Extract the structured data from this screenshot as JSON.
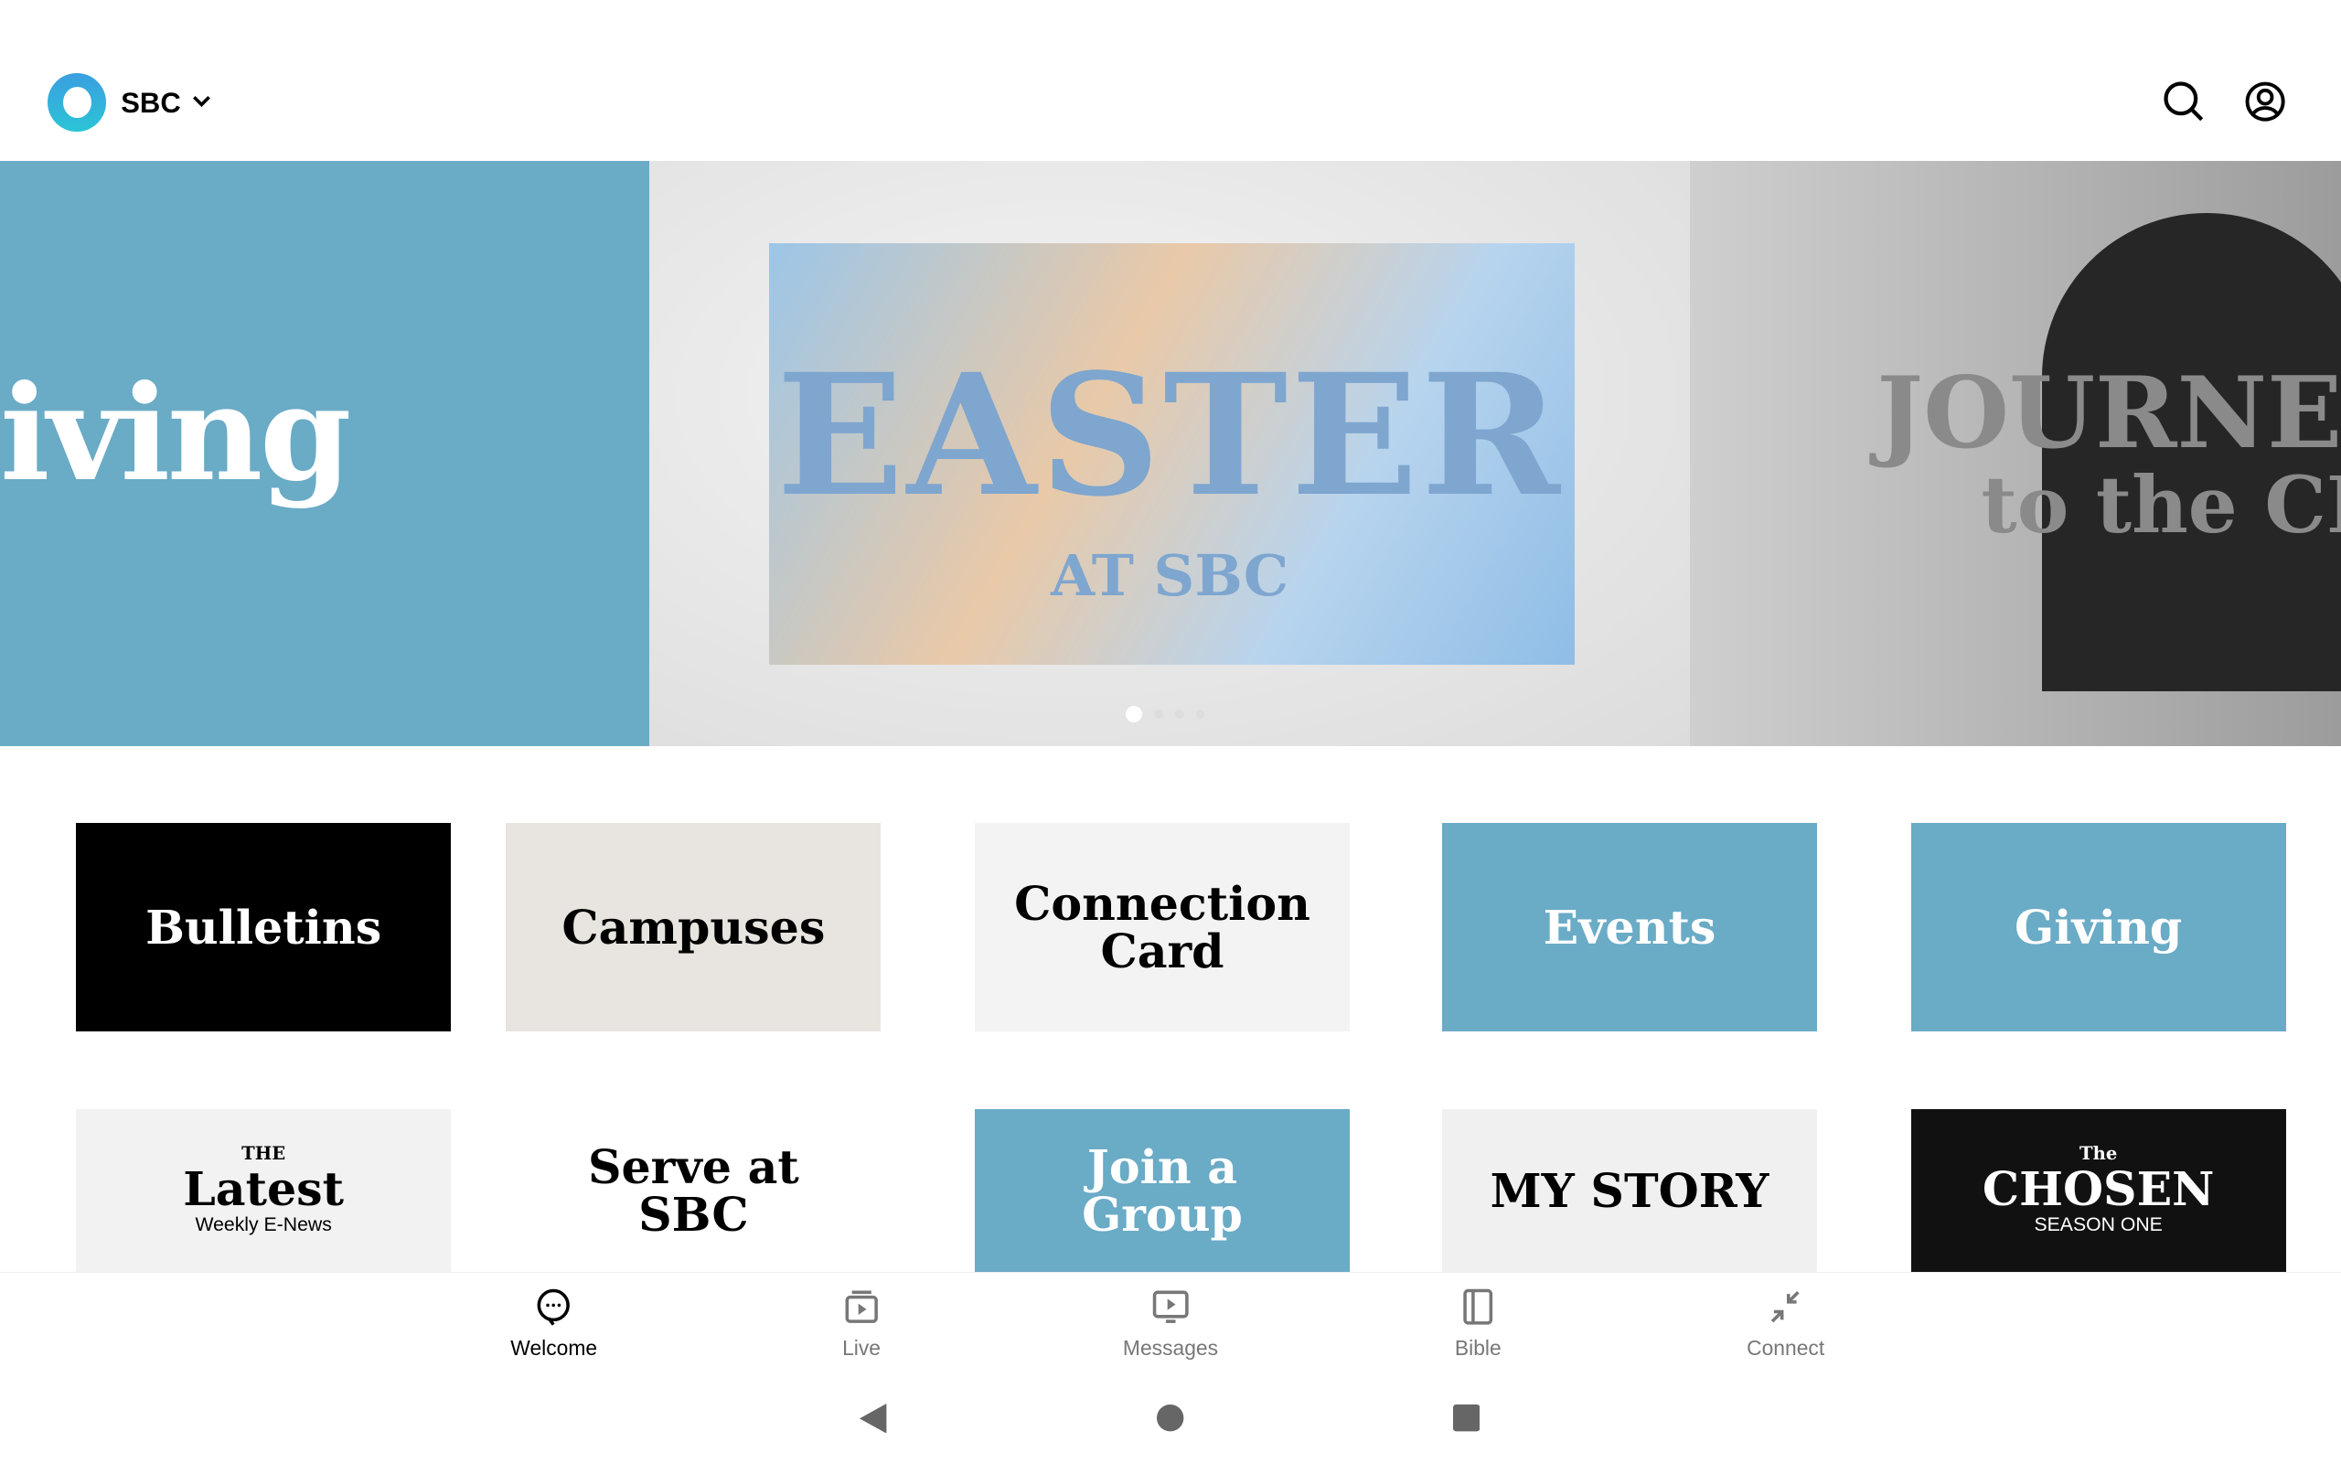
{
  "header": {
    "org_name": "SBC",
    "search_icon": "search-icon",
    "account_icon": "account-circle-icon"
  },
  "carousel": {
    "slides": [
      {
        "text": "iving"
      },
      {
        "title": "EASTER",
        "subtitle": "AT SBC"
      },
      {
        "line1": "JOURNEY",
        "line2": "to the CR"
      }
    ],
    "active_index": 0,
    "count": 4
  },
  "tiles": [
    {
      "label": "Bulletins",
      "bg": "#000000",
      "color": "#ffffff"
    },
    {
      "label": "Campuses",
      "bg": "#e8e4df",
      "color": "#000000"
    },
    {
      "label": "Connection Card",
      "bg": "#f3f3f3",
      "color": "#000000"
    },
    {
      "label": "Events",
      "bg": "#6aabc6",
      "color": "#ffffff"
    },
    {
      "label": "Giving",
      "bg": "#6aabc6",
      "color": "#ffffff"
    },
    {
      "label": "Latest",
      "prefix": "THE",
      "sub": "Weekly E-News",
      "bg": "#f2f2f2",
      "color": "#000000"
    },
    {
      "label": "Serve at SBC",
      "bg": "#ffffff",
      "color": "#000000"
    },
    {
      "label": "Join a Group",
      "bg": "#6aabc6",
      "color": "#ffffff"
    },
    {
      "label": "MY STORY",
      "bg": "#f0f0f0",
      "color": "#000000"
    },
    {
      "label": "CHOSEN",
      "prefix": "The",
      "sub": "SEASON ONE",
      "bg": "#111111",
      "color": "#ffffff"
    }
  ],
  "nav": [
    {
      "label": "Welcome",
      "icon": "chat-bubble-icon",
      "active": true
    },
    {
      "label": "Live",
      "icon": "live-video-icon"
    },
    {
      "label": "Messages",
      "icon": "tv-play-icon"
    },
    {
      "label": "Bible",
      "icon": "book-icon"
    },
    {
      "label": "Connect",
      "icon": "arrows-collapse-icon"
    }
  ]
}
